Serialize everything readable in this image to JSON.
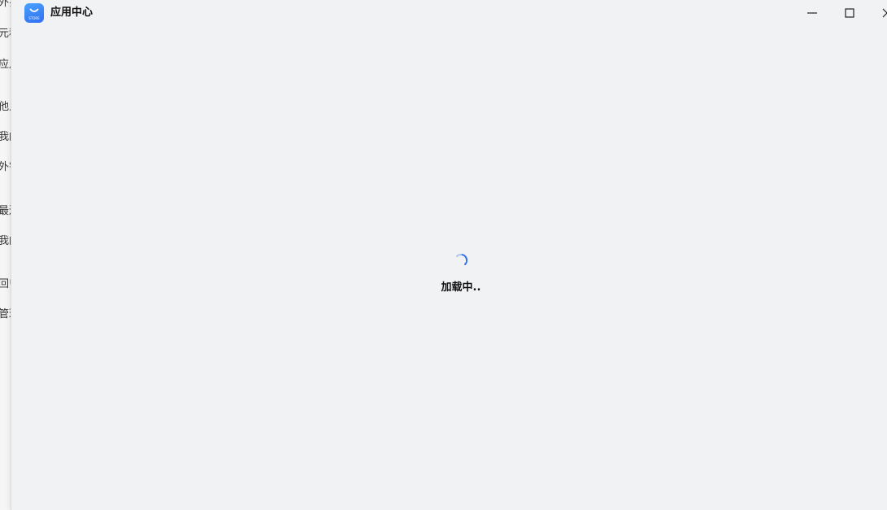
{
  "background_sidebar": {
    "items": [
      "外扌",
      "元科",
      "应月",
      "他人",
      "我的",
      "外钅",
      "最辽",
      "我的",
      "回屮",
      "管理"
    ]
  },
  "window": {
    "app_title": "应用中心",
    "app_icon": "store-app-icon",
    "app_icon_text": "STORE",
    "controls": {
      "minimize": "minimize-icon",
      "maximize": "maximize-icon",
      "close": "close-icon"
    }
  },
  "content": {
    "loading_text": "加载中..",
    "spinner": "loading-spinner-icon"
  },
  "colors": {
    "window_bg": "#f1f2f4",
    "accent": "#2f6ef0",
    "text": "#111111"
  }
}
